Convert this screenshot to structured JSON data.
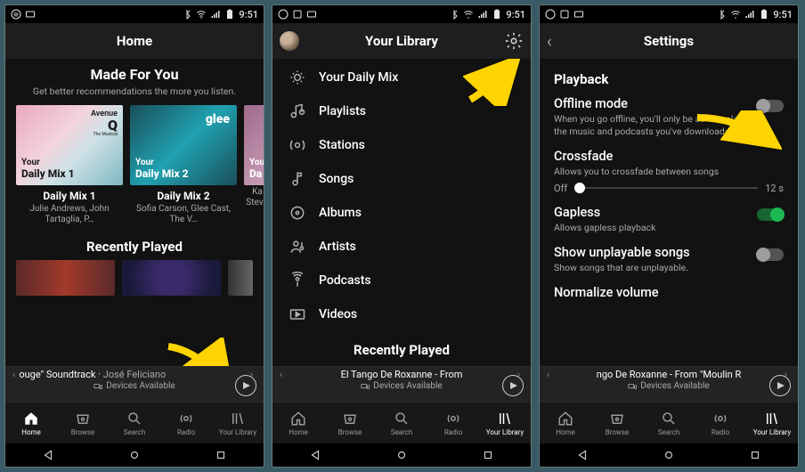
{
  "status": {
    "time": "9:51"
  },
  "home": {
    "title": "Home",
    "made_title": "Made For You",
    "made_sub": "Get better recommendations the more you listen.",
    "mixes": [
      {
        "art_label_top": "Your",
        "art_label_big": "Daily Mix 1",
        "badge_line1": "Avenue",
        "badge_line2": "Q",
        "name": "Daily Mix 1",
        "sub": "Julie Andrews, John Tartaglia, P…"
      },
      {
        "art_label_top": "Your",
        "art_label_big": "Daily Mix 2",
        "badge_line1": "glee",
        "name": "Daily Mix 2",
        "sub": "Sofia Carson, Glee Cast, The V…"
      },
      {
        "art_label_top": "Your",
        "art_label_big": "Da",
        "name": "",
        "sub": "Ka\nStev…"
      }
    ],
    "recently_played": "Recently Played"
  },
  "library": {
    "title": "Your Library",
    "items": [
      {
        "icon": "daily-mix-icon",
        "label": "Your Daily Mix"
      },
      {
        "icon": "playlists-icon",
        "label": "Playlists"
      },
      {
        "icon": "stations-icon",
        "label": "Stations"
      },
      {
        "icon": "songs-icon",
        "label": "Songs"
      },
      {
        "icon": "albums-icon",
        "label": "Albums"
      },
      {
        "icon": "artists-icon",
        "label": "Artists"
      },
      {
        "icon": "podcasts-icon",
        "label": "Podcasts"
      },
      {
        "icon": "videos-icon",
        "label": "Videos"
      }
    ],
    "recently_played": "Recently Played"
  },
  "settings": {
    "title": "Settings",
    "section": "Playback",
    "offline": {
      "title": "Offline mode",
      "desc": "When you go offline, you'll only be able to play the music and podcasts you've downloaded.",
      "on": false
    },
    "crossfade": {
      "title": "Crossfade",
      "desc": "Allows you to crossfade between songs",
      "left": "Off",
      "right": "12 s",
      "value": 0
    },
    "gapless": {
      "title": "Gapless",
      "desc": "Allows gapless playback",
      "on": true
    },
    "unplayable": {
      "title": "Show unplayable songs",
      "desc": "Show songs that are unplayable.",
      "on": false
    },
    "normalize": {
      "title": "Normalize volume"
    }
  },
  "nowplaying": {
    "home": {
      "track": "ouge\" Soundtrack",
      "separator": " · ",
      "artist": "José Feliciano",
      "devices": "Devices Available"
    },
    "library": {
      "track": "El Tango De Roxanne - From",
      "devices": "Devices Available"
    },
    "settings": {
      "track": "ngo De Roxanne - From \"Moulin R",
      "devices": "Devices Available"
    }
  },
  "tabs": [
    "Home",
    "Browse",
    "Search",
    "Radio",
    "Your Library"
  ]
}
